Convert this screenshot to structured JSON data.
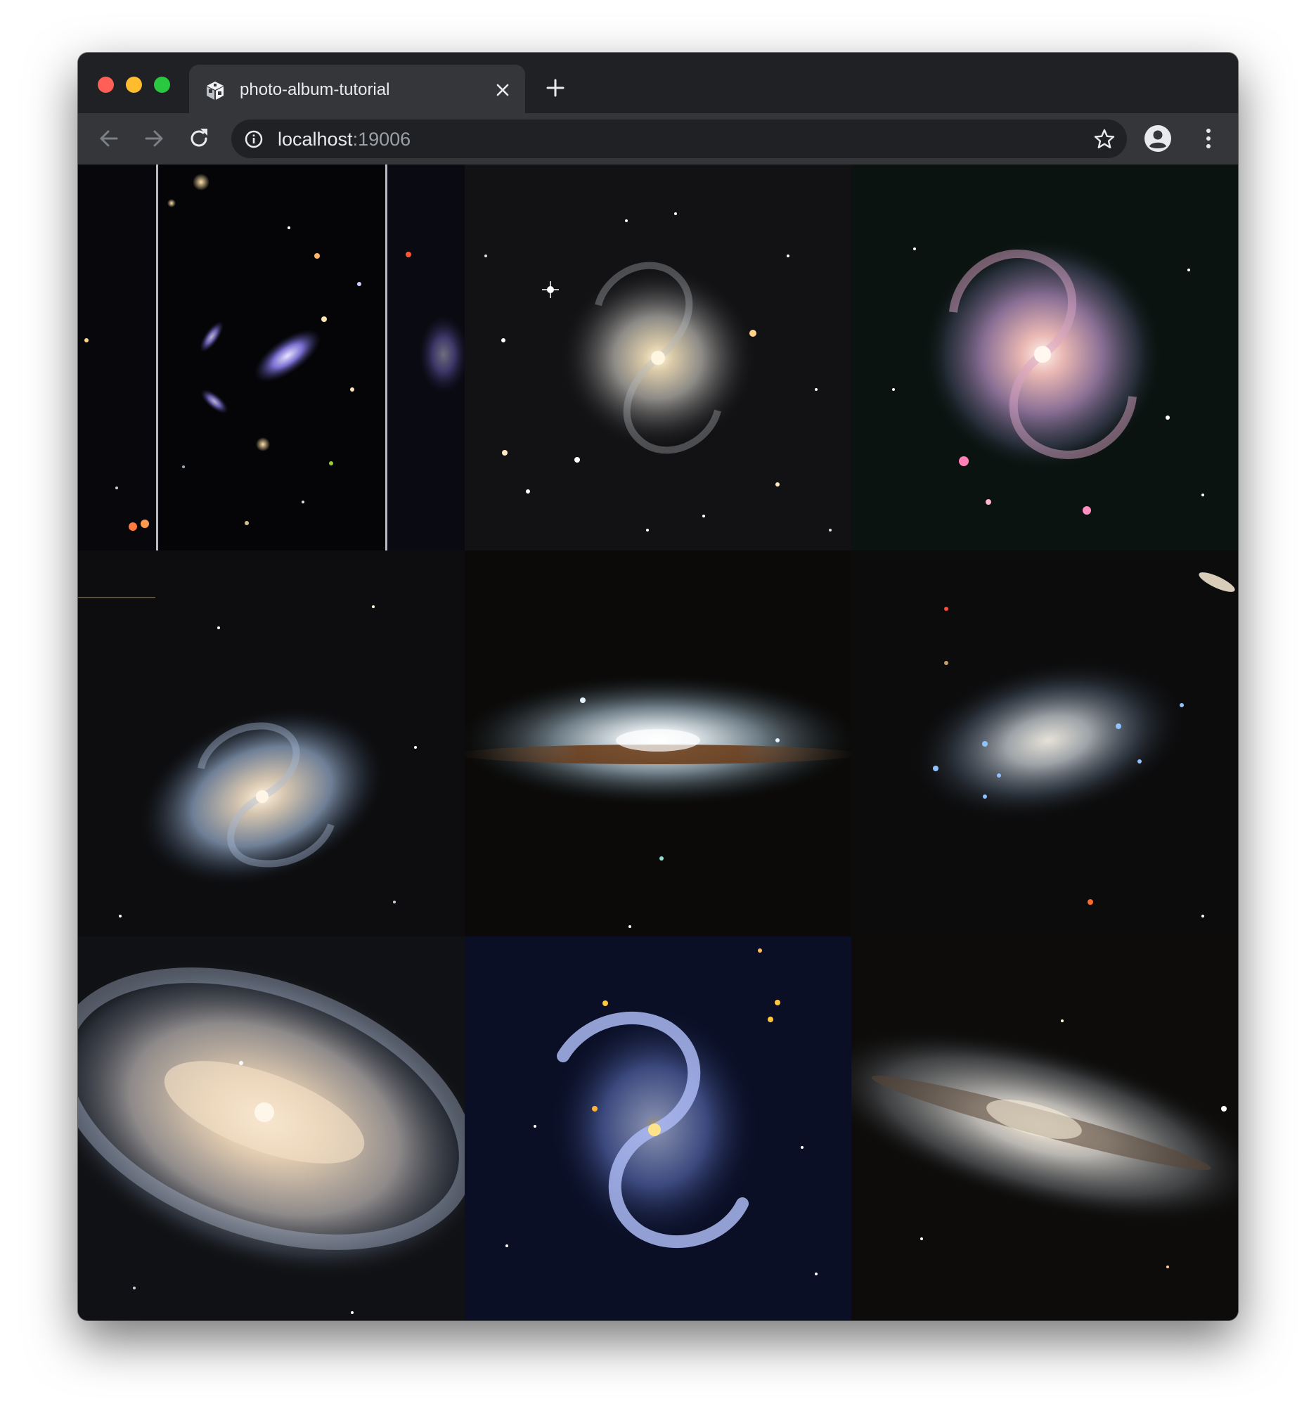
{
  "browser": {
    "tab": {
      "title": "photo-album-tutorial"
    },
    "address_bar": {
      "host": "localhost",
      "port": ":19006"
    },
    "traffic_lights": {
      "close": "#ff5f57",
      "minimize": "#febc2e",
      "zoom": "#28c840"
    },
    "icons": {
      "favicon": "expo-cube-icon",
      "tab_close": "close-icon",
      "new_tab": "plus-icon",
      "back": "arrow-left-icon",
      "forward": "arrow-right-icon",
      "reload": "reload-icon",
      "site_info": "info-icon",
      "bookmark": "star-icon",
      "profile": "account-circle-icon",
      "menu": "kebab-menu-icon"
    }
  },
  "gallery": {
    "columns": 3,
    "photos": [
      {
        "subject": "deep field galaxy cluster"
      },
      {
        "subject": "face-on spiral galaxy"
      },
      {
        "subject": "pink spiral galaxy"
      },
      {
        "subject": "tilted spiral galaxy"
      },
      {
        "subject": "edge-on dust lane galaxy"
      },
      {
        "subject": "irregular galaxy"
      },
      {
        "subject": "barred spiral galaxy"
      },
      {
        "subject": "ultraviolet spiral galaxy"
      },
      {
        "subject": "edge-on spiral galaxy"
      }
    ]
  }
}
